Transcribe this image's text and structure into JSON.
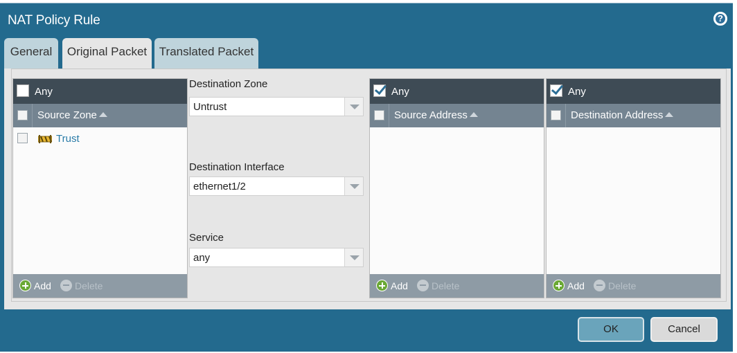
{
  "dialog": {
    "title": "NAT Policy Rule",
    "help_icon": "help-icon"
  },
  "tabs": [
    {
      "label": "General",
      "active": false
    },
    {
      "label": "Original Packet",
      "active": true
    },
    {
      "label": "Translated Packet",
      "active": false
    }
  ],
  "source_zone": {
    "any_label": "Any",
    "any_checked": false,
    "column_header": "Source Zone",
    "rows": [
      {
        "label": "Trust",
        "icon": "zone-icon"
      }
    ],
    "add_label": "Add",
    "delete_label": "Delete"
  },
  "destination": {
    "zone_label": "Destination Zone",
    "zone_value": "Untrust",
    "interface_label": "Destination Interface",
    "interface_value": "ethernet1/2",
    "service_label": "Service",
    "service_value": "any"
  },
  "source_address": {
    "any_label": "Any",
    "any_checked": true,
    "column_header": "Source Address",
    "add_label": "Add",
    "delete_label": "Delete"
  },
  "destination_address": {
    "any_label": "Any",
    "any_checked": true,
    "column_header": "Destination Address",
    "add_label": "Add",
    "delete_label": "Delete"
  },
  "buttons": {
    "ok": "OK",
    "cancel": "Cancel"
  },
  "colors": {
    "dialog_bg": "#236a8e",
    "grid_header": "#3e4b55",
    "column_header": "#748491",
    "link": "#2a7ca8",
    "add_icon": "#6aa834"
  }
}
